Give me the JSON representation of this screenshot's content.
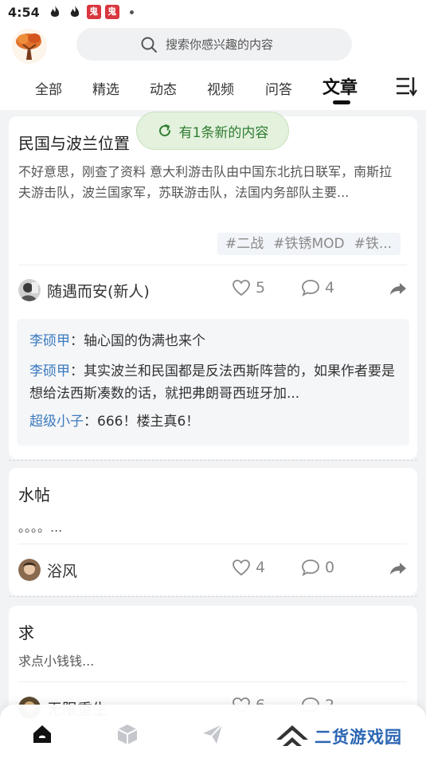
{
  "status_bar": {
    "time": "4:54",
    "icons": [
      "flame-icon",
      "flame-icon",
      "red-app-icon",
      "red-app-icon",
      "dot-icon"
    ],
    "red_badge": "鬼"
  },
  "header": {
    "logo": "tree-logo",
    "search": {
      "placeholder": "搜索你感兴趣的内容"
    },
    "tabs": [
      {
        "label": "全部",
        "active": false
      },
      {
        "label": "精选",
        "active": false
      },
      {
        "label": "动态",
        "active": false
      },
      {
        "label": "视频",
        "active": false
      },
      {
        "label": "问答",
        "active": false
      },
      {
        "label": "文章",
        "active": true
      }
    ],
    "menu_icon": "category-menu-icon"
  },
  "toast": {
    "text": "有1条新的内容",
    "icon": "refresh-icon",
    "color": "#2f7d32"
  },
  "posts": [
    {
      "title": "民国与波兰位置",
      "body": "不好意思，刚查了资料 意大利游击队由中国东北抗日联军，南斯拉夫游击队，波兰国家军，苏联游击队，法国内务部队主要...",
      "tags": [
        "#二战",
        "#铁锈MOD",
        "#铁..."
      ],
      "author": "随遇而安(新人)",
      "likes": "5",
      "comments_count": "4",
      "comments": [
        {
          "user": "李硕甲",
          "text": "：轴心国的伪满也来个"
        },
        {
          "user": "李硕甲",
          "text": "：其实波兰和民国都是反法西斯阵营的，如果作者要是想给法西斯凑数的话，就把弗朗哥西班牙加..."
        },
        {
          "user": "超级小子",
          "text": "：666！楼主真6！"
        }
      ]
    },
    {
      "title": "水帖",
      "body": "。。。。...",
      "author": "浴风",
      "likes": "4",
      "comments_count": "0"
    },
    {
      "title": "求",
      "body": "求点小钱钱...",
      "author": "无限重生",
      "likes": "6",
      "comments_count": "2"
    }
  ],
  "bottom_nav": {
    "items": [
      "home-icon",
      "cube-icon",
      "paper-plane-icon"
    ],
    "watermark": "二货游戏园"
  },
  "colors": {
    "accent_link": "#3b7bbf",
    "toast_bg": "#e3f1dd",
    "watermark": "#2b66b3"
  }
}
